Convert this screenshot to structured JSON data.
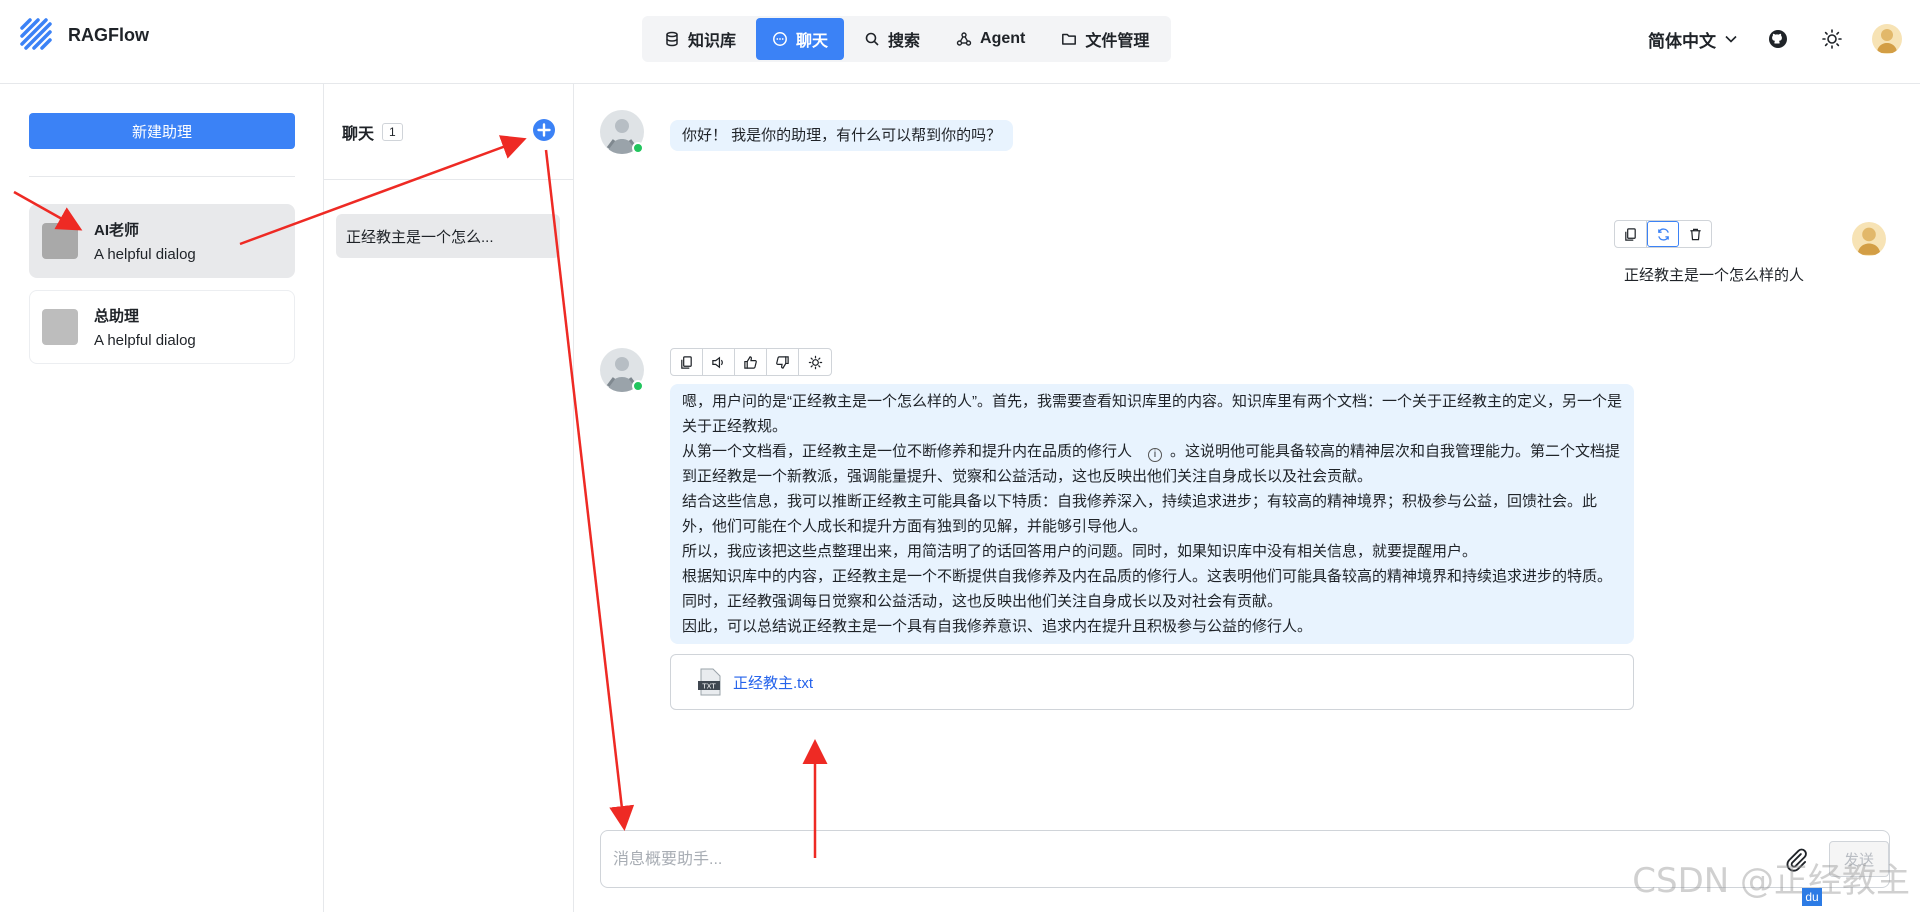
{
  "app": {
    "name": "RAGFlow"
  },
  "nav": {
    "items": [
      {
        "label": "知识库",
        "icon": "database-icon",
        "active": false
      },
      {
        "label": "聊天",
        "icon": "chat-icon",
        "active": true
      },
      {
        "label": "搜索",
        "icon": "search-icon",
        "active": false
      },
      {
        "label": "Agent",
        "icon": "agent-icon",
        "active": false
      },
      {
        "label": "文件管理",
        "icon": "folder-icon",
        "active": false
      }
    ]
  },
  "header": {
    "language": "简体中文"
  },
  "sidebar": {
    "new_assistant_label": "新建助理",
    "assistants": [
      {
        "name": "AI老师",
        "description": "A helpful dialog",
        "active": true
      },
      {
        "name": "总助理",
        "description": "A helpful dialog",
        "active": false
      }
    ]
  },
  "conversations": {
    "title": "聊天",
    "count": "1",
    "items": [
      {
        "label": "正经教主是一个怎么..."
      }
    ]
  },
  "chat": {
    "greeting": "你好！ 我是你的助理，有什么可以帮到你的吗？",
    "user_message": "正经教主是一个怎么样的人",
    "answer": {
      "p1": "嗯，用户问的是“正经教主是一个怎么样的人”。首先，我需要查看知识库里的内容。知识库里有两个文档：一个关于正经教主的定义，另一个是关于正经教规。",
      "p2a": "从第一个文档看，正经教主是一位不断修养和提升内在品质的修行人",
      "p2b": "。这说明他可能具备较高的精神层次和自我管理能力。第二个文档提到正经教是一个新教派，强调能量提升、觉察和公益活动，这也反映出他们关注自身成长以及社会贡献。",
      "p3": "结合这些信息，我可以推断正经教主可能具备以下特质：自我修养深入，持续追求进步；有较高的精神境界；积极参与公益，回馈社会。此外，他们可能在个人成长和提升方面有独到的见解，并能够引导他人。",
      "p4": "所以，我应该把这些点整理出来，用简洁明了的话回答用户的问题。同时，如果知识库中没有相关信息，就要提醒用户。",
      "p5": "根据知识库中的内容，正经教主是一个不断提供自我修养及内在品质的修行人。这表明他们可能具备较高的精神境界和持续追求进步的特质。同时，正经教强调每日觉察和公益活动，这也反映出他们关注自身成长以及对社会有贡献。",
      "p6": "因此，可以总结说正经教主是一个具有自我修养意识、追求内在提升且积极参与公益的修行人。"
    },
    "info_glyph": "i",
    "file": {
      "name": "正经教主.txt",
      "type_label": "TXT"
    },
    "input_placeholder": "消息概要助手...",
    "send_label": "发送"
  },
  "watermark": {
    "text": "CSDN @正经教主",
    "badge": "du"
  },
  "colors": {
    "accent": "#3b82f6",
    "bubble": "#e8f3fe",
    "annotation": "#ee2a24"
  }
}
